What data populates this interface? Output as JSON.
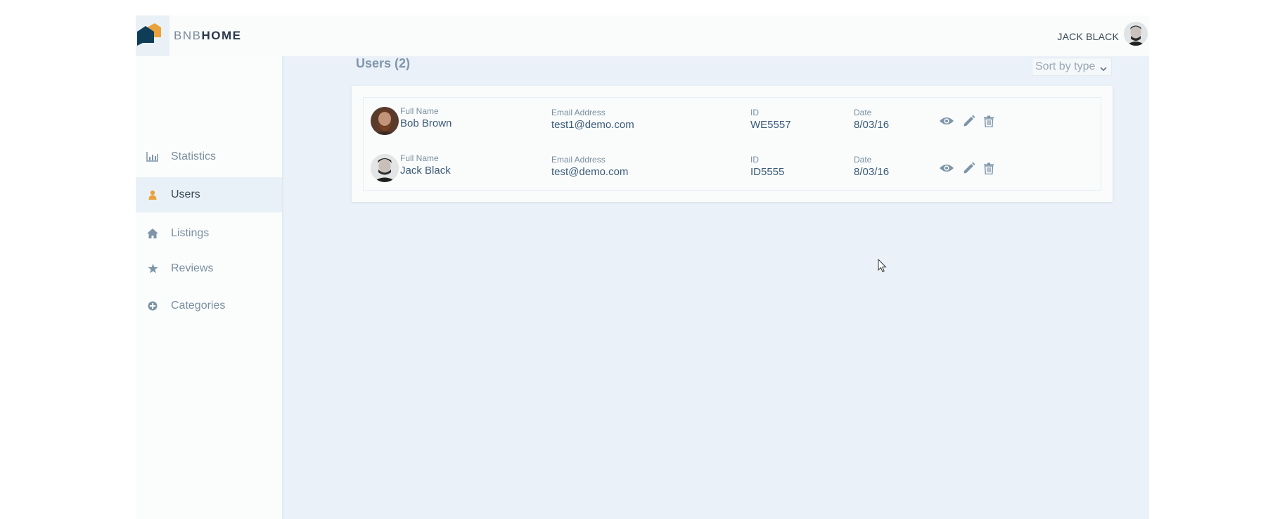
{
  "brand": {
    "light": "BNB",
    "bold": "HOME"
  },
  "header": {
    "user_name": "JACK BLACK"
  },
  "sidebar": {
    "items": [
      {
        "label": "Statistics",
        "icon": "bar-chart-icon",
        "active": false
      },
      {
        "label": "Users",
        "icon": "user-icon",
        "active": true
      },
      {
        "label": "Listings",
        "icon": "home-icon",
        "active": false
      },
      {
        "label": "Reviews",
        "icon": "star-icon",
        "active": false
      },
      {
        "label": "Categories",
        "icon": "plus-circle-icon",
        "active": false
      }
    ]
  },
  "main": {
    "title": "Users (2)",
    "sort_label": "Sort by type"
  },
  "users": [
    {
      "name_label": "Full Name",
      "name": "Bob Brown",
      "email_label": "Email Address",
      "email": "test1@demo.com",
      "id_label": "ID",
      "id": "WE5557",
      "date_label": "Date",
      "date": "8/03/16"
    },
    {
      "name_label": "Full Name",
      "name": "Jack Black",
      "email_label": "Email Address",
      "email": "test@demo.com",
      "id_label": "ID",
      "id": "ID5555",
      "date_label": "Date",
      "date": "8/03/16"
    }
  ],
  "colors": {
    "accent": "#e9a23b",
    "brand_dark": "#2b3a4a",
    "main_bg": "#eaf1f8",
    "icon_muted": "#7e95a8"
  }
}
